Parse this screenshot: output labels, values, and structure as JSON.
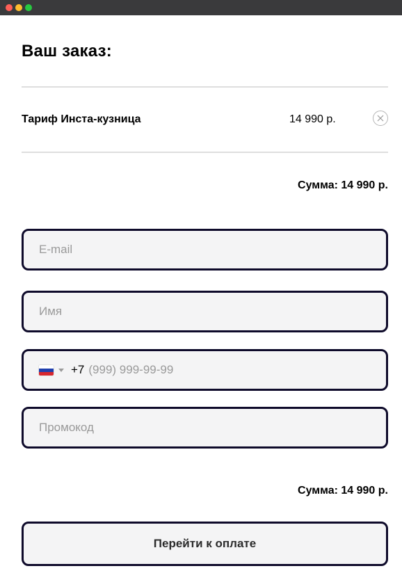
{
  "window": {
    "controls": [
      "close",
      "minimize",
      "zoom"
    ]
  },
  "order": {
    "title": "Ваш заказ:",
    "items": [
      {
        "name": "Тариф Инста-кузница",
        "price": "14 990 р.",
        "remove_icon": "close-circle-icon"
      }
    ],
    "sum_top": "Сумма: 14 990 р.",
    "sum_bottom": "Сумма: 14 990 р."
  },
  "form": {
    "email": {
      "placeholder": "E-mail",
      "value": ""
    },
    "name": {
      "placeholder": "Имя",
      "value": ""
    },
    "phone": {
      "country_flag": "russia-flag-icon",
      "code": "+7",
      "placeholder": "(999) 999-99-99",
      "value": ""
    },
    "promo": {
      "placeholder": "Промокод",
      "value": ""
    }
  },
  "actions": {
    "pay_label": "Перейти к оплате"
  },
  "colors": {
    "field_border": "#0e0a2a",
    "field_bg": "#f4f4f5",
    "divider": "#dedede",
    "placeholder": "#9a9a9a"
  }
}
